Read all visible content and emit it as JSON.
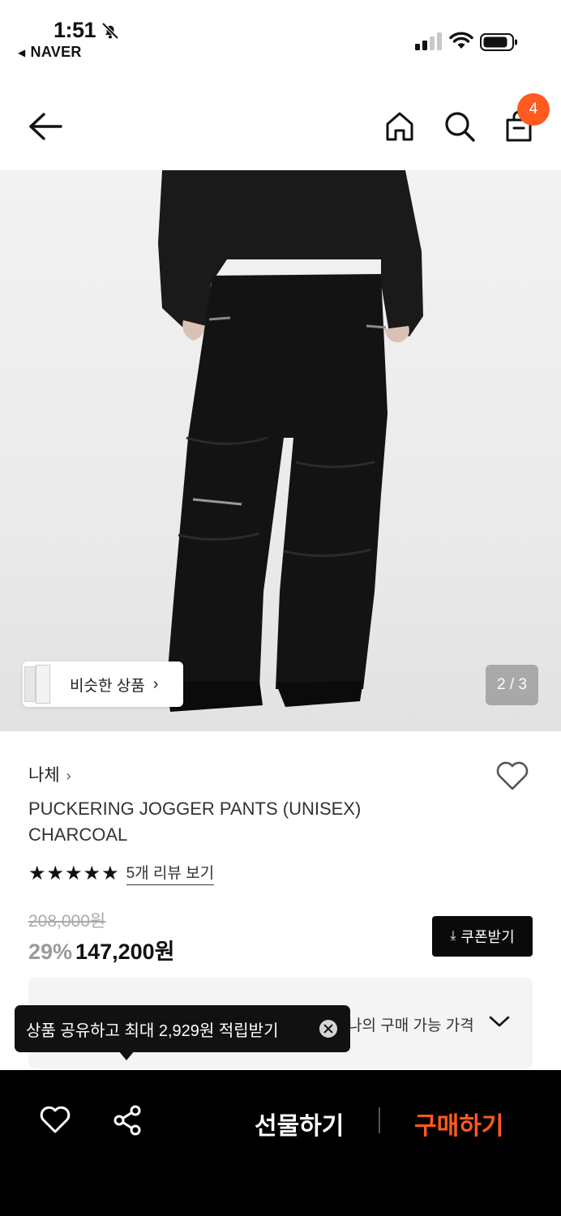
{
  "status_bar": {
    "time": "1:51",
    "back_app": "NAVER"
  },
  "nav": {
    "cart_count": "4"
  },
  "gallery": {
    "similar_label": "비슷한 상품",
    "counter": "2 / 3"
  },
  "product": {
    "brand": "나체",
    "title": "PUCKERING JOGGER PANTS (UNISEX) CHARCOAL",
    "rating_stars": 5,
    "review_link": "5개 리뷰 보기",
    "original_price": "208,000원",
    "discount": "29%",
    "price": "147,200원"
  },
  "coupon": {
    "label": "쿠폰받기"
  },
  "my_price": {
    "label": "나의 구매 가능 가격"
  },
  "toast": {
    "text": "상품 공유하고 최대 2,929원 적립받기"
  },
  "bottom_bar": {
    "gift_label": "선물하기",
    "buy_label": "구매하기"
  },
  "colors": {
    "accent": "#ff5a1f",
    "badge": "#ff5a1f",
    "toast_bg": "#111111",
    "bottom_bar_bg": "#000000"
  }
}
